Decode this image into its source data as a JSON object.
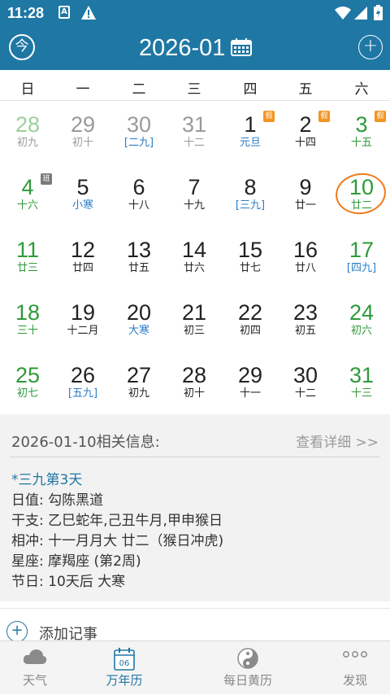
{
  "status_bar": {
    "time": "11:28",
    "a_badge": "A",
    "icons": [
      "a-icon",
      "warning-icon",
      "wifi-icon",
      "signal-icon",
      "battery-icon"
    ]
  },
  "header": {
    "today_button": "今",
    "month_title": "2026-01",
    "calendar_icon": "calendar-icon",
    "add_icon": "+"
  },
  "colors": {
    "primary": "#1f77a4",
    "green": "#2e9a3a",
    "holiday_badge": "#f39421",
    "work_badge": "#7a7a7a",
    "today_circle": "#f07a1a",
    "term_blue": "#2b7cc4"
  },
  "weekdays": [
    "日",
    "一",
    "二",
    "三",
    "四",
    "五",
    "六"
  ],
  "weeks": [
    [
      {
        "day": "28",
        "lunar": "初九",
        "style": "lightgreen",
        "lunar_style": "gray"
      },
      {
        "day": "29",
        "lunar": "初十",
        "style": "gray",
        "lunar_style": "gray"
      },
      {
        "day": "30",
        "lunar": "[二九]",
        "style": "gray",
        "lunar_style": "blue"
      },
      {
        "day": "31",
        "lunar": "十二",
        "style": "gray",
        "lunar_style": "gray"
      },
      {
        "day": "1",
        "lunar": "元旦",
        "style": "black",
        "lunar_style": "blue",
        "badge": "假",
        "badge_type": "holiday"
      },
      {
        "day": "2",
        "lunar": "十四",
        "style": "black",
        "lunar_style": "black",
        "badge": "假",
        "badge_type": "holiday"
      },
      {
        "day": "3",
        "lunar": "十五",
        "style": "green",
        "lunar_style": "green",
        "badge": "假",
        "badge_type": "holiday"
      }
    ],
    [
      {
        "day": "4",
        "lunar": "十六",
        "style": "green",
        "lunar_style": "green",
        "badge": "班",
        "badge_type": "work"
      },
      {
        "day": "5",
        "lunar": "小寒",
        "style": "black",
        "lunar_style": "blue"
      },
      {
        "day": "6",
        "lunar": "十八",
        "style": "black",
        "lunar_style": "black"
      },
      {
        "day": "7",
        "lunar": "十九",
        "style": "black",
        "lunar_style": "black"
      },
      {
        "day": "8",
        "lunar": "[三九]",
        "style": "black",
        "lunar_style": "blue"
      },
      {
        "day": "9",
        "lunar": "廿一",
        "style": "black",
        "lunar_style": "black"
      },
      {
        "day": "10",
        "lunar": "廿二",
        "style": "green",
        "lunar_style": "green",
        "today": true
      }
    ],
    [
      {
        "day": "11",
        "lunar": "廿三",
        "style": "green",
        "lunar_style": "green"
      },
      {
        "day": "12",
        "lunar": "廿四",
        "style": "black",
        "lunar_style": "black"
      },
      {
        "day": "13",
        "lunar": "廿五",
        "style": "black",
        "lunar_style": "black"
      },
      {
        "day": "14",
        "lunar": "廿六",
        "style": "black",
        "lunar_style": "black"
      },
      {
        "day": "15",
        "lunar": "廿七",
        "style": "black",
        "lunar_style": "black"
      },
      {
        "day": "16",
        "lunar": "廿八",
        "style": "black",
        "lunar_style": "black"
      },
      {
        "day": "17",
        "lunar": "[四九]",
        "style": "green",
        "lunar_style": "blue"
      }
    ],
    [
      {
        "day": "18",
        "lunar": "三十",
        "style": "green",
        "lunar_style": "green"
      },
      {
        "day": "19",
        "lunar": "十二月",
        "style": "black",
        "lunar_style": "black"
      },
      {
        "day": "20",
        "lunar": "大寒",
        "style": "black",
        "lunar_style": "blue"
      },
      {
        "day": "21",
        "lunar": "初三",
        "style": "black",
        "lunar_style": "black"
      },
      {
        "day": "22",
        "lunar": "初四",
        "style": "black",
        "lunar_style": "black"
      },
      {
        "day": "23",
        "lunar": "初五",
        "style": "black",
        "lunar_style": "black"
      },
      {
        "day": "24",
        "lunar": "初六",
        "style": "green",
        "lunar_style": "green"
      }
    ],
    [
      {
        "day": "25",
        "lunar": "初七",
        "style": "green",
        "lunar_style": "green"
      },
      {
        "day": "26",
        "lunar": "[五九]",
        "style": "black",
        "lunar_style": "blue"
      },
      {
        "day": "27",
        "lunar": "初九",
        "style": "black",
        "lunar_style": "black"
      },
      {
        "day": "28",
        "lunar": "初十",
        "style": "black",
        "lunar_style": "black"
      },
      {
        "day": "29",
        "lunar": "十一",
        "style": "black",
        "lunar_style": "black"
      },
      {
        "day": "30",
        "lunar": "十二",
        "style": "black",
        "lunar_style": "black"
      },
      {
        "day": "31",
        "lunar": "十三",
        "style": "green",
        "lunar_style": "green"
      }
    ]
  ],
  "info": {
    "heading": "2026-01-10相关信息:",
    "more_link": "查看详细 >>",
    "highlight": "*三九第3天",
    "rows": [
      {
        "label": "日值:",
        "value": "勾陈黑道"
      },
      {
        "label": "干支:",
        "value": "乙巳蛇年,己丑牛月,甲申猴日"
      },
      {
        "label": "相冲:",
        "value": "十一月月大 廿二（猴日冲虎)"
      },
      {
        "label": "星座:",
        "value": "摩羯座 (第2周)"
      },
      {
        "label": "节日:",
        "value": "10天后 大寒"
      }
    ]
  },
  "note": {
    "plus": "+",
    "label": "添加记事"
  },
  "bottom_nav": [
    {
      "label": "天气",
      "icon": "cloud-icon",
      "active": false
    },
    {
      "label": "万年历",
      "icon": "calendar-day-icon",
      "icon_text": "06",
      "active": true
    },
    {
      "label": "每日黄历",
      "icon": "yin-yang-icon",
      "active": false
    },
    {
      "label": "发现",
      "icon": "more-dots-icon",
      "active": false
    }
  ]
}
